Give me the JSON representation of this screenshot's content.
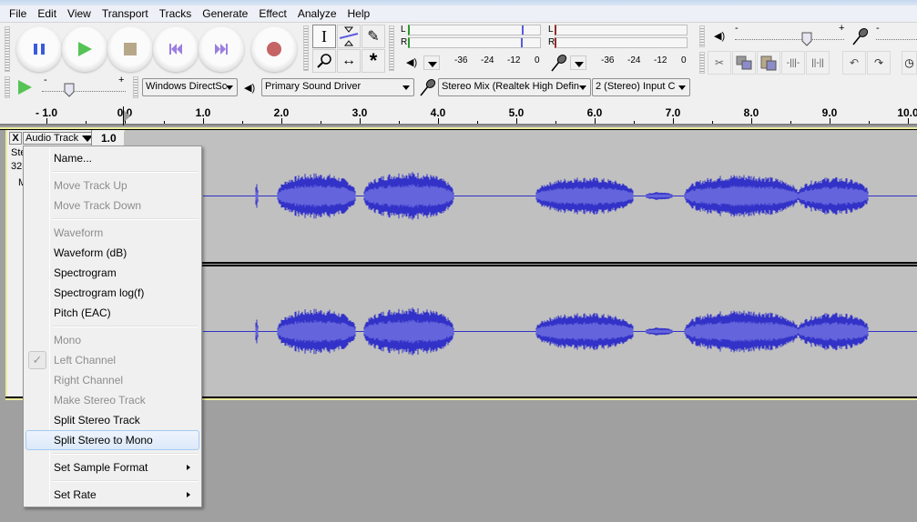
{
  "menubar": [
    "File",
    "Edit",
    "View",
    "Transport",
    "Tracks",
    "Generate",
    "Effect",
    "Analyze",
    "Help"
  ],
  "transport": {
    "buttons": [
      "pause",
      "play",
      "stop",
      "skip-to-start",
      "skip-to-end",
      "record"
    ],
    "colors": {
      "pause": "#3b5bdb",
      "play": "#4cbf4c",
      "stop": "#b7a88a",
      "skip": "#9b7fe0",
      "record": "#c46464"
    }
  },
  "tools": [
    "selection",
    "envelope",
    "draw",
    "zoom",
    "time-shift",
    "multi"
  ],
  "meters": {
    "playback": {
      "channels": [
        "L",
        "R"
      ],
      "scale": [
        "-36",
        "-24",
        "-12",
        "0"
      ],
      "level_l_fraction": 0.84,
      "level_r_fraction": 0.83
    },
    "record": {
      "channels": [
        "L",
        "R"
      ],
      "scale": [
        "-36",
        "-24",
        "-12",
        "0"
      ]
    }
  },
  "mixer": {
    "minus": "-",
    "plus": "+",
    "playback_volume_fraction": 0.76
  },
  "playspeed": {
    "minus": "-",
    "plus": "+",
    "value_fraction": 0.32
  },
  "devices": {
    "host": "Windows DirectSc",
    "output": "Primary Sound Driver",
    "input": "Stereo Mix (Realtek High Defin",
    "channels": "2 (Stereo) Input C"
  },
  "ruler": {
    "labels": [
      "- 1.0",
      "0.0",
      "1.0",
      "2.0",
      "3.0",
      "4.0",
      "5.0",
      "6.0",
      "7.0",
      "8.0",
      "9.0",
      "10.0"
    ]
  },
  "track": {
    "close_label": "X",
    "name": "Audio Track",
    "scale_top": "1.0",
    "info_line1": "Ste",
    "info_line2": "32-",
    "mute_label": "M",
    "waveform_colors": {
      "outer": "#3232c8",
      "inner": "#6464dc",
      "background": "#c0c0c0"
    }
  },
  "context_menu": {
    "items": [
      {
        "label": "Name...",
        "enabled": true
      },
      {
        "sep": true
      },
      {
        "label": "Move Track Up",
        "enabled": false
      },
      {
        "label": "Move Track Down",
        "enabled": false
      },
      {
        "sep": true
      },
      {
        "label": "Waveform",
        "enabled": false
      },
      {
        "label": "Waveform (dB)",
        "enabled": true
      },
      {
        "label": "Spectrogram",
        "enabled": true
      },
      {
        "label": "Spectrogram log(f)",
        "enabled": true
      },
      {
        "label": "Pitch (EAC)",
        "enabled": true
      },
      {
        "sep": true
      },
      {
        "label": "Mono",
        "enabled": false
      },
      {
        "label": "Left Channel",
        "enabled": false,
        "checked": true
      },
      {
        "label": "Right Channel",
        "enabled": false
      },
      {
        "label": "Make Stereo Track",
        "enabled": false
      },
      {
        "label": "Split Stereo Track",
        "enabled": true
      },
      {
        "label": "Split Stereo to Mono",
        "enabled": true,
        "highlighted": true
      },
      {
        "sep": true
      },
      {
        "label": "Set Sample Format",
        "enabled": true,
        "submenu": true
      },
      {
        "sep": true
      },
      {
        "label": "Set Rate",
        "enabled": true,
        "submenu": true
      }
    ]
  }
}
